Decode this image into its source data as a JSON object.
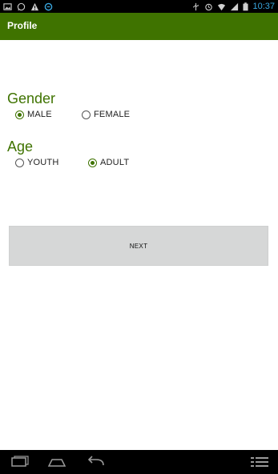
{
  "status_bar": {
    "time": "10:37",
    "left_icons": [
      "image-icon",
      "whatsapp-icon",
      "warning-icon",
      "internet-icon"
    ],
    "right_icons": [
      "usb-icon",
      "alarm-icon",
      "wifi-icon",
      "signal-icon",
      "battery-icon"
    ]
  },
  "action_bar": {
    "title": "Profile",
    "color": "#3f7300"
  },
  "gender": {
    "label": "Gender",
    "options": [
      {
        "label": "MALE",
        "selected": true
      },
      {
        "label": "FEMALE",
        "selected": false
      }
    ]
  },
  "age": {
    "label": "Age",
    "options": [
      {
        "label": "YOUTH",
        "selected": false
      },
      {
        "label": "ADULT",
        "selected": true
      }
    ]
  },
  "next_button": {
    "label": "NEXT"
  },
  "nav_bar": {
    "icons": [
      "recent-apps-icon",
      "home-icon",
      "back-icon",
      "menu-icon"
    ]
  }
}
